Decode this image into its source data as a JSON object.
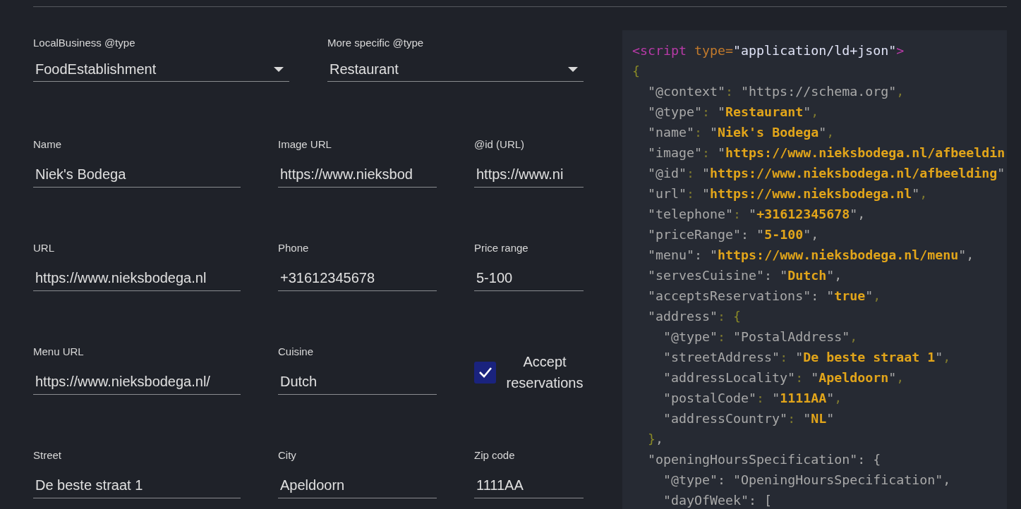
{
  "selects": [
    {
      "label": "LocalBusiness @type",
      "value": "FoodEstablishment"
    },
    {
      "label": "More specific @type",
      "value": "Restaurant"
    }
  ],
  "fields": [
    {
      "kind": "text",
      "label": "Name",
      "value": "Niek's Bodega"
    },
    {
      "kind": "text",
      "label": "Image URL",
      "value": "https://www.nieksbod"
    },
    {
      "kind": "text",
      "label": "@id (URL)",
      "value": "https://www.ni"
    },
    {
      "kind": "text",
      "label": "URL",
      "value": "https://www.nieksbodega.nl"
    },
    {
      "kind": "text",
      "label": "Phone",
      "value": "+31612345678"
    },
    {
      "kind": "text",
      "label": "Price range",
      "value": "5-100"
    },
    {
      "kind": "text",
      "label": "Menu URL",
      "value": "https://www.nieksbodega.nl/"
    },
    {
      "kind": "text",
      "label": "Cuisine",
      "value": "Dutch"
    },
    {
      "kind": "checkbox",
      "label": "Accept reservations",
      "checked": true
    },
    {
      "kind": "text",
      "label": "Street",
      "value": "De beste straat 1"
    },
    {
      "kind": "text",
      "label": "City",
      "value": "Apeldoorn"
    },
    {
      "kind": "text",
      "label": "Zip code",
      "value": "1111AA"
    }
  ],
  "code_lines": [
    [
      {
        "text": "<script",
        "kind": "tag"
      },
      {
        "text": " type",
        "kind": "attr"
      },
      {
        "text": "=",
        "kind": "attr"
      },
      {
        "text": "\"application/ld+json\"",
        "kind": "str"
      },
      {
        "text": ">",
        "kind": "tag"
      }
    ],
    [
      {
        "text": "{",
        "kind": "brace"
      }
    ],
    [
      {
        "text": "  \"@context\"",
        "kind": "key"
      },
      {
        "text": ": ",
        "kind": "p"
      },
      {
        "text": "\"https://schema.org\"",
        "kind": "key"
      },
      {
        "text": ",",
        "kind": "p"
      }
    ],
    [
      {
        "text": "  \"@type\"",
        "kind": "key"
      },
      {
        "text": ": ",
        "kind": "p"
      },
      {
        "text": "\"",
        "kind": "key"
      },
      {
        "text": "Restaurant",
        "kind": "val"
      },
      {
        "text": "\"",
        "kind": "key"
      },
      {
        "text": ",",
        "kind": "p"
      }
    ],
    [
      {
        "text": "  \"name\"",
        "kind": "key"
      },
      {
        "text": ": ",
        "kind": "p"
      },
      {
        "text": "\"",
        "kind": "key"
      },
      {
        "text": "Niek's Bodega",
        "kind": "val"
      },
      {
        "text": "\"",
        "kind": "key"
      },
      {
        "text": ",",
        "kind": "p"
      }
    ],
    [
      {
        "text": "  \"image\"",
        "kind": "key"
      },
      {
        "text": ": ",
        "kind": "p"
      },
      {
        "text": "\"",
        "kind": "key"
      },
      {
        "text": "https://www.nieksbodega.nl/afbeeldin",
        "kind": "val"
      }
    ],
    [
      {
        "text": "  \"@id\"",
        "kind": "key"
      },
      {
        "text": ": ",
        "kind": "p"
      },
      {
        "text": "\"",
        "kind": "key"
      },
      {
        "text": "https://www.nieksbodega.nl/afbeelding",
        "kind": "val"
      },
      {
        "text": "\"",
        "kind": "key"
      }
    ],
    [
      {
        "text": "  \"url\"",
        "kind": "key"
      },
      {
        "text": ": ",
        "kind": "p"
      },
      {
        "text": "\"",
        "kind": "key"
      },
      {
        "text": "https://www.nieksbodega.nl",
        "kind": "val"
      },
      {
        "text": "\"",
        "kind": "key"
      },
      {
        "text": ",",
        "kind": "p"
      }
    ],
    [
      {
        "text": "  \"telephone\"",
        "kind": "key"
      },
      {
        "text": ": ",
        "kind": "p"
      },
      {
        "text": "\"",
        "kind": "key"
      },
      {
        "text": "+31612345678",
        "kind": "val"
      },
      {
        "text": "\",",
        "kind": "key"
      }
    ],
    [
      {
        "text": "  \"priceRange\"",
        "kind": "key"
      },
      {
        "text": ": ",
        "kind": "key"
      },
      {
        "text": "\"",
        "kind": "key"
      },
      {
        "text": "5-100",
        "kind": "val"
      },
      {
        "text": "\",",
        "kind": "key"
      }
    ],
    [
      {
        "text": "  \"menu\"",
        "kind": "key"
      },
      {
        "text": ": ",
        "kind": "key"
      },
      {
        "text": "\"",
        "kind": "key"
      },
      {
        "text": "https://www.nieksbodega.nl/menu",
        "kind": "val"
      },
      {
        "text": "\",",
        "kind": "key"
      }
    ],
    [
      {
        "text": "  \"servesCuisine\"",
        "kind": "key"
      },
      {
        "text": ": ",
        "kind": "key"
      },
      {
        "text": "\"",
        "kind": "key"
      },
      {
        "text": "Dutch",
        "kind": "val"
      },
      {
        "text": "\",",
        "kind": "key"
      }
    ],
    [
      {
        "text": "  \"acceptsReservations\"",
        "kind": "key"
      },
      {
        "text": ": ",
        "kind": "key"
      },
      {
        "text": "\"",
        "kind": "key"
      },
      {
        "text": "true",
        "kind": "val"
      },
      {
        "text": "\"",
        "kind": "key"
      },
      {
        "text": ",",
        "kind": "p"
      }
    ],
    [
      {
        "text": "  \"address\"",
        "kind": "key"
      },
      {
        "text": ": ",
        "kind": "p"
      },
      {
        "text": "{",
        "kind": "brace"
      }
    ],
    [
      {
        "text": "    \"@type\"",
        "kind": "key"
      },
      {
        "text": ": ",
        "kind": "p"
      },
      {
        "text": "\"PostalAddress\"",
        "kind": "key"
      },
      {
        "text": ",",
        "kind": "p"
      }
    ],
    [
      {
        "text": "    \"streetAddress\"",
        "kind": "key"
      },
      {
        "text": ": ",
        "kind": "p"
      },
      {
        "text": "\"",
        "kind": "key"
      },
      {
        "text": "De beste straat 1",
        "kind": "val"
      },
      {
        "text": "\"",
        "kind": "key"
      },
      {
        "text": ",",
        "kind": "p"
      }
    ],
    [
      {
        "text": "    \"addressLocality\"",
        "kind": "key"
      },
      {
        "text": ": ",
        "kind": "p"
      },
      {
        "text": "\"",
        "kind": "key"
      },
      {
        "text": "Apeldoorn",
        "kind": "val"
      },
      {
        "text": "\"",
        "kind": "key"
      },
      {
        "text": ",",
        "kind": "p"
      }
    ],
    [
      {
        "text": "    \"postalCode\"",
        "kind": "key"
      },
      {
        "text": ": ",
        "kind": "p"
      },
      {
        "text": "\"",
        "kind": "key"
      },
      {
        "text": "1111AA",
        "kind": "val"
      },
      {
        "text": "\"",
        "kind": "key"
      },
      {
        "text": ",",
        "kind": "p"
      }
    ],
    [
      {
        "text": "    \"addressCountry\"",
        "kind": "key"
      },
      {
        "text": ": ",
        "kind": "p"
      },
      {
        "text": "\"",
        "kind": "key"
      },
      {
        "text": "NL",
        "kind": "val"
      },
      {
        "text": "\"",
        "kind": "key"
      }
    ],
    [
      {
        "text": "  }",
        "kind": "brace"
      },
      {
        "text": ",",
        "kind": "key"
      }
    ],
    [
      {
        "text": "  \"openingHoursSpecification\"",
        "kind": "key"
      },
      {
        "text": ": {",
        "kind": "key"
      }
    ],
    [
      {
        "text": "    \"@type\"",
        "kind": "key"
      },
      {
        "text": ": ",
        "kind": "key"
      },
      {
        "text": "\"OpeningHoursSpecification\",",
        "kind": "key"
      }
    ],
    [
      {
        "text": "    \"dayOfWeek\"",
        "kind": "key"
      },
      {
        "text": ": [",
        "kind": "key"
      }
    ]
  ]
}
